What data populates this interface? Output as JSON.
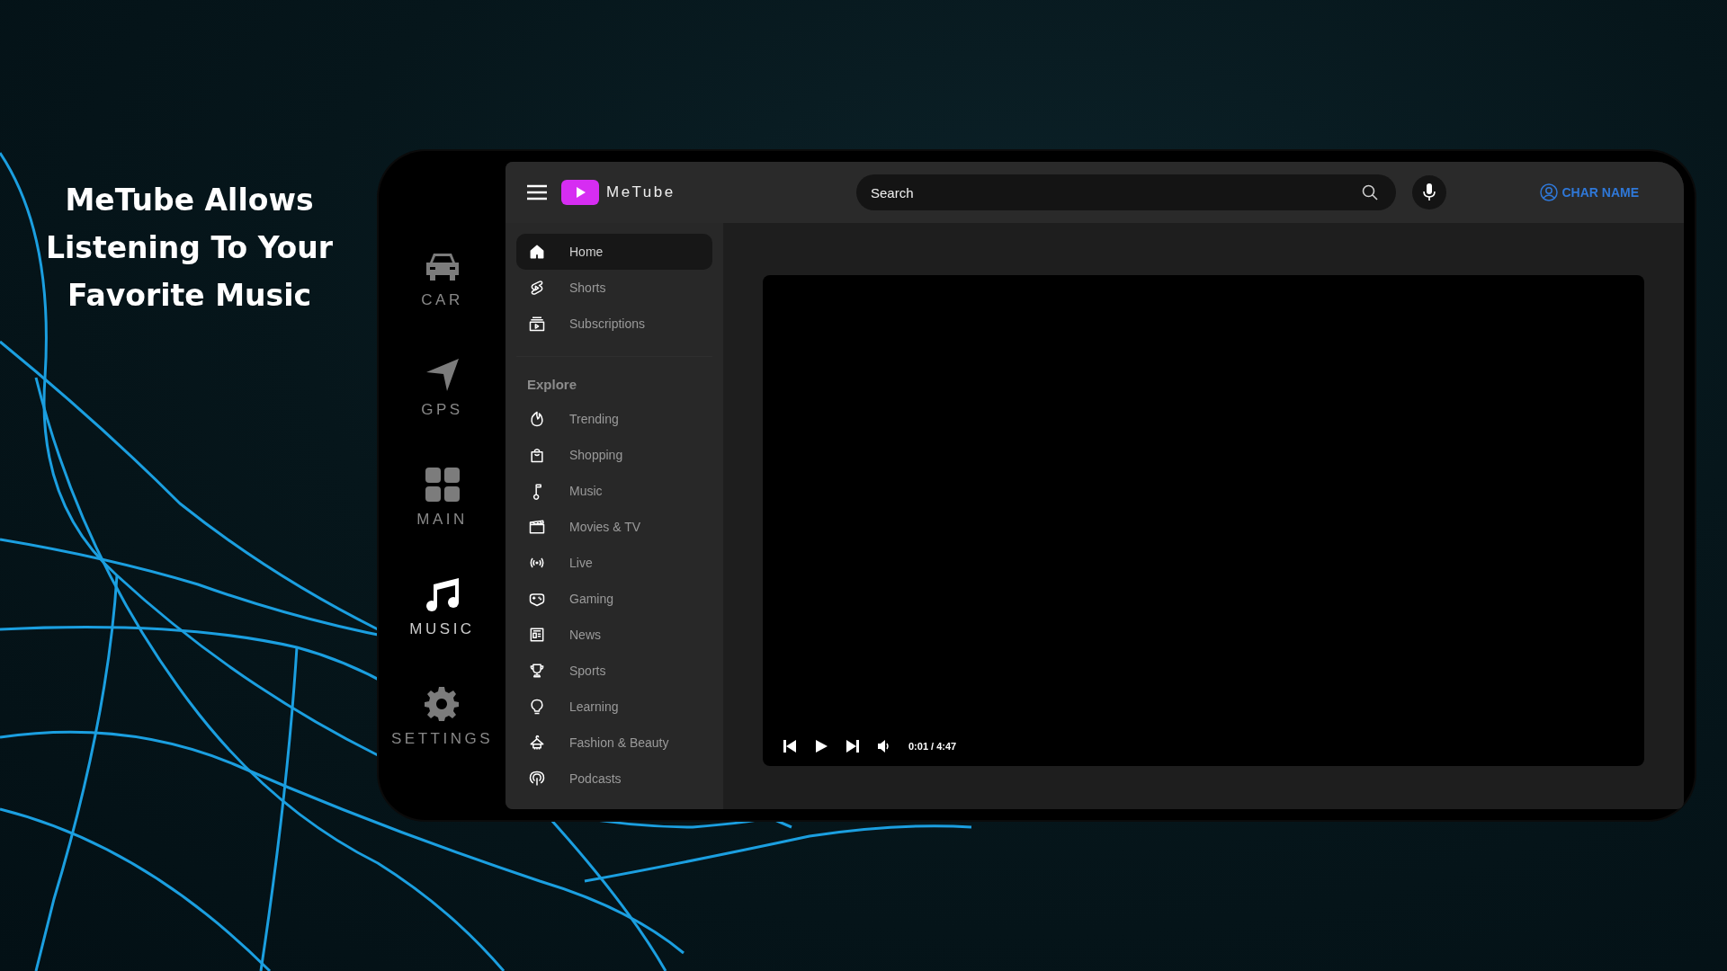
{
  "headline": "MeTube Allows Listening To Your Favorite Music",
  "car_nav": [
    {
      "label": "CAR",
      "selected": false
    },
    {
      "label": "GPS",
      "selected": false
    },
    {
      "label": "MAIN",
      "selected": false
    },
    {
      "label": "MUSIC",
      "selected": true
    },
    {
      "label": "SETTINGS",
      "selected": false
    }
  ],
  "app": {
    "logo": "MeTube",
    "search": {
      "placeholder": "Search"
    },
    "account": "CHAR NAME"
  },
  "sidebar": {
    "items": [
      {
        "label": "Home",
        "selected": true
      },
      {
        "label": "Shorts",
        "selected": false
      },
      {
        "label": "Subscriptions",
        "selected": false
      }
    ],
    "explore_heading": "Explore",
    "explore_items": [
      {
        "label": "Trending"
      },
      {
        "label": "Shopping"
      },
      {
        "label": "Music"
      },
      {
        "label": "Movies & TV"
      },
      {
        "label": "Live"
      },
      {
        "label": "Gaming"
      },
      {
        "label": "News"
      },
      {
        "label": "Sports"
      },
      {
        "label": "Learning"
      },
      {
        "label": "Fashion & Beauty"
      },
      {
        "label": "Podcasts"
      }
    ]
  },
  "player": {
    "time": "0:01 / 4:47"
  }
}
